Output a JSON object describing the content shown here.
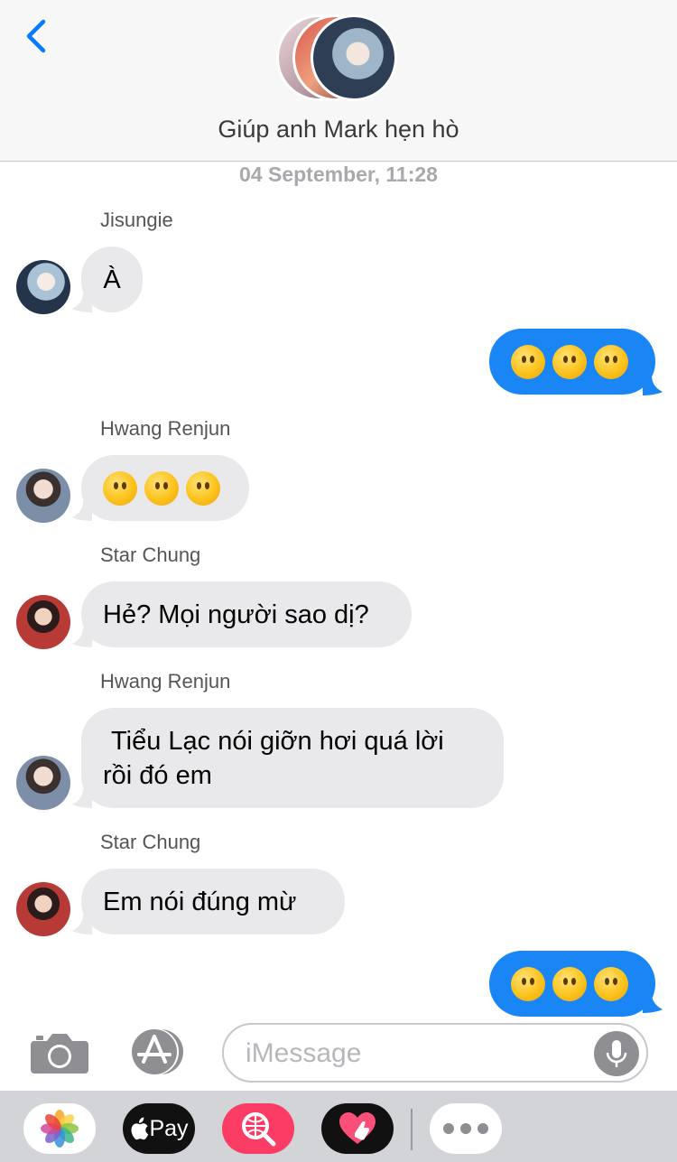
{
  "header": {
    "group_name": "Giúp anh Mark hẹn hò"
  },
  "timestamp": "04 September, 11:28",
  "messages": [
    {
      "sender": "Jisungie",
      "text": "À",
      "direction": "incoming"
    },
    {
      "text": "😶😶😶",
      "direction": "outgoing"
    },
    {
      "sender": "Hwang Renjun",
      "text": "😶😶😶",
      "direction": "incoming"
    },
    {
      "sender": "Star Chung",
      "text": "Hẻ? Mọi người sao dị?",
      "direction": "incoming"
    },
    {
      "sender": "Hwang Renjun",
      "text_line1": "Tiểu Lạc nói giỡn hơi quá lời",
      "text_line2": "rồi đó em",
      "direction": "incoming"
    },
    {
      "sender": "Star Chung",
      "text": "Em nói đúng mừ",
      "direction": "incoming"
    },
    {
      "text": "😶😶😶",
      "direction": "outgoing"
    }
  ],
  "input": {
    "placeholder": "iMessage",
    "value": ""
  },
  "app_drawer": {
    "pay_label": "Pay",
    "icons": [
      "photos-icon",
      "apple-pay-icon",
      "image-search-icon",
      "digital-touch-icon",
      "more-icon"
    ]
  },
  "colors": {
    "outgoing_bubble": "#1a86f5",
    "incoming_bubble": "#e9e9eb",
    "accent": "#0a7aff",
    "search_app": "#fb3c64"
  }
}
